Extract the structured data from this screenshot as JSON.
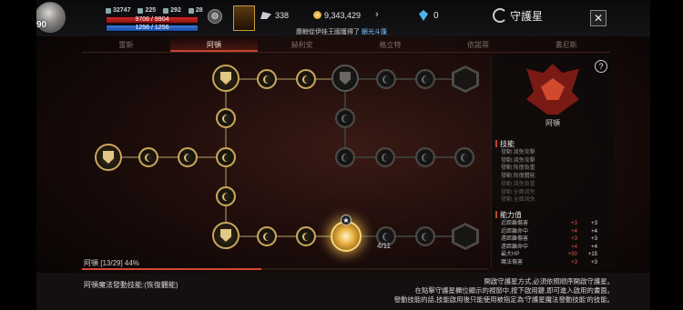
{
  "hud": {
    "level": "90",
    "stats": [
      "32747",
      "225",
      "292",
      "28"
    ],
    "hp": "9706 / 9904",
    "mp": "1256 / 1256",
    "wing_value": "338",
    "gold": "9,343,429",
    "gems": "0",
    "window_title": "守護星",
    "close": "✕",
    "next_arrow": "›"
  },
  "banner": {
    "prefix": "塵鯨從伊娃王國獲得了",
    "highlight": "銀光斗篷"
  },
  "tabs": [
    "雷斯",
    "阿頓",
    "赫利安",
    "格立特",
    "依諾蒂",
    "書尼斯"
  ],
  "active_tab_index": 1,
  "tree": {
    "node_progress_label": "4/11"
  },
  "panel": {
    "help": "?",
    "constellation_name": "阿頓",
    "skills_title": "技能",
    "skills": [
      {
        "text": "發動:減免攻擊",
        "dim": false
      },
      {
        "text": "發動:減免攻擊",
        "dim": false
      },
      {
        "text": "發動:恢復負重",
        "dim": false
      },
      {
        "text": "發動:恢復體能",
        "dim": false
      },
      {
        "text": "發動:減免負重",
        "dim": true
      },
      {
        "text": "發動:全面減免",
        "dim": true
      },
      {
        "text": "發動:全面減免",
        "dim": true
      }
    ],
    "ability_title": "能力值",
    "abilities": [
      {
        "name": "近距離傷害",
        "a": "+3",
        "b": "+3"
      },
      {
        "name": "近距離命中",
        "a": "+4",
        "b": "+4"
      },
      {
        "name": "遠距離傷害",
        "a": "+3",
        "b": "+3"
      },
      {
        "name": "遠距離命中",
        "a": "+4",
        "b": "+4"
      },
      {
        "name": "最大HP",
        "a": "+50",
        "b": "+15"
      },
      {
        "name": "魔法傷害",
        "a": "+3",
        "b": "+3"
      }
    ]
  },
  "progress": {
    "label": "阿頓 [13/29] 44%",
    "percent": 44
  },
  "bottom": {
    "left": "阿頓魔法發動技能:(恢復體能)",
    "right_lines": [
      "開啟守護星方式,必須依照順序開啟守護星。",
      "在點擊守護星欄位顯示的視窗中,按下啟用鍵,即可進入啟用的畫面。",
      "發動技能的話,技能啟用後只能使用被指定為'守護星魔法發動技能'的技能。"
    ]
  }
}
